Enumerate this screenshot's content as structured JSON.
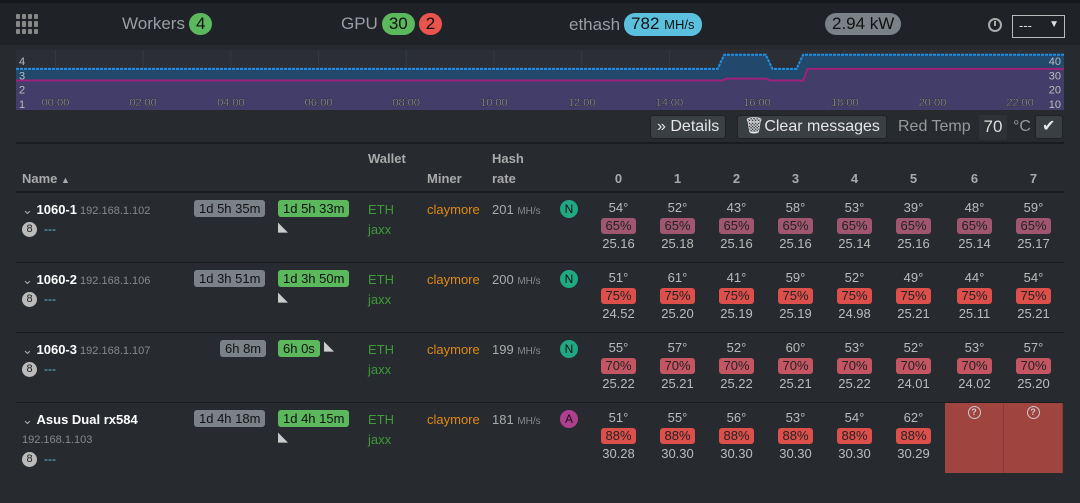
{
  "navbar": {
    "workers_label": "Workers",
    "workers_count": "4",
    "gpu_label": "GPU",
    "gpu_ok": "30",
    "gpu_bad": "2",
    "algo_label": "ethash",
    "hashrate": "782",
    "hashrate_unit": "MH/s",
    "power": "2.94 kW",
    "range_select": "---"
  },
  "chart_data": {
    "type": "area",
    "x_ticks": [
      "00:00",
      "02:00",
      "04:00",
      "06:00",
      "08:00",
      "10:00",
      "12:00",
      "14:00",
      "16:00",
      "18:00",
      "20:00",
      "22:00"
    ],
    "left_ticks": [
      "1",
      "2",
      "3",
      "4"
    ],
    "right_ticks": [
      "10",
      "20",
      "30",
      "40"
    ],
    "xlim_hours": [
      -0.9,
      23
    ],
    "ylim_right": [
      7,
      50
    ],
    "series": [
      {
        "color": "#1e90e6",
        "points": [
          [
            -0.9,
            36.5
          ],
          [
            15.1,
            36.5
          ],
          [
            15.25,
            46.6
          ],
          [
            16.2,
            46.6
          ],
          [
            16.35,
            36.5
          ],
          [
            16.9,
            36.5
          ],
          [
            17.05,
            46.6
          ],
          [
            23,
            46.6
          ]
        ]
      },
      {
        "color": "#a0207a",
        "points": [
          [
            -0.9,
            28.1
          ],
          [
            15.2,
            28.1
          ],
          [
            15.3,
            29.5
          ],
          [
            16.2,
            29.5
          ],
          [
            16.3,
            28.1
          ],
          [
            17.05,
            28.1
          ],
          [
            17.15,
            36.5
          ],
          [
            23,
            36.5
          ]
        ]
      }
    ]
  },
  "toolbar": {
    "details": "Details",
    "clear": "Clear messages",
    "red_temp_label": "Red Temp",
    "red_temp": "70",
    "unit": "°C"
  },
  "table": {
    "headers": {
      "name": "Name",
      "wallet": "Wallet",
      "miner": "Miner",
      "hash1": "Hash",
      "hash2": "rate",
      "gpus": [
        "0",
        "1",
        "2",
        "3",
        "4",
        "5",
        "6",
        "7"
      ]
    },
    "rows": [
      {
        "name": "1060-1",
        "ip": "192.168.1.102",
        "count": "8",
        "note": "---",
        "up1": "1d 5h 35m",
        "up2": "1d 5h 33m",
        "coin": "ETH",
        "wallet": "jaxx",
        "miner": "claymore",
        "hash": "201",
        "unit": "MH/s",
        "type": "N",
        "typecolor": "#1fa883",
        "pctcolor": "#a0566e",
        "gpus": [
          [
            "54°",
            "65%",
            "25.16"
          ],
          [
            "52°",
            "65%",
            "25.18"
          ],
          [
            "43°",
            "65%",
            "25.16"
          ],
          [
            "58°",
            "65%",
            "25.16"
          ],
          [
            "53°",
            "65%",
            "25.14"
          ],
          [
            "39°",
            "65%",
            "25.16"
          ],
          [
            "48°",
            "65%",
            "25.14"
          ],
          [
            "59°",
            "65%",
            "25.17"
          ]
        ]
      },
      {
        "name": "1060-2",
        "ip": "192.168.1.106",
        "count": "8",
        "note": "---",
        "up1": "1d 3h 51m",
        "up2": "1d 3h 50m",
        "coin": "ETH",
        "wallet": "jaxx",
        "miner": "claymore",
        "hash": "200",
        "unit": "MH/s",
        "type": "N",
        "typecolor": "#1fa883",
        "pctcolor": "#dc4f4a",
        "gpus": [
          [
            "51°",
            "75%",
            "24.52"
          ],
          [
            "61°",
            "75%",
            "25.20"
          ],
          [
            "41°",
            "75%",
            "25.19"
          ],
          [
            "59°",
            "75%",
            "25.19"
          ],
          [
            "52°",
            "75%",
            "24.98"
          ],
          [
            "49°",
            "75%",
            "25.21"
          ],
          [
            "44°",
            "75%",
            "25.11"
          ],
          [
            "54°",
            "75%",
            "25.21"
          ]
        ]
      },
      {
        "name": "1060-3",
        "ip": "192.168.1.107",
        "count": "8",
        "note": "---",
        "up1": "6h 8m",
        "up2": "6h 0s",
        "coin": "ETH",
        "wallet": "jaxx",
        "miner": "claymore",
        "hash": "199",
        "unit": "MH/s",
        "type": "N",
        "typecolor": "#1fa883",
        "pctcolor": "#c45563",
        "gpus": [
          [
            "55°",
            "70%",
            "25.22"
          ],
          [
            "57°",
            "70%",
            "25.21"
          ],
          [
            "52°",
            "70%",
            "25.22"
          ],
          [
            "60°",
            "70%",
            "25.21"
          ],
          [
            "53°",
            "70%",
            "25.22"
          ],
          [
            "52°",
            "70%",
            "24.01"
          ],
          [
            "53°",
            "70%",
            "24.02"
          ],
          [
            "57°",
            "70%",
            "25.20"
          ]
        ]
      },
      {
        "name": "Asus Dual rx584",
        "ip": "192.168.1.103",
        "count": "8",
        "note": "---",
        "up1": "1d 4h 18m",
        "up2": "1d 4h 15m",
        "coin": "ETH",
        "wallet": "jaxx",
        "miner": "claymore",
        "hash": "181",
        "unit": "MH/s",
        "type": "A",
        "typecolor": "#b0408f",
        "pctcolor": "#dc4f4a",
        "gpus": [
          [
            "51°",
            "88%",
            "30.28"
          ],
          [
            "55°",
            "88%",
            "30.30"
          ],
          [
            "56°",
            "88%",
            "30.30"
          ],
          [
            "53°",
            "88%",
            "30.30"
          ],
          [
            "54°",
            "88%",
            "30.30"
          ],
          [
            "62°",
            "88%",
            "30.29"
          ],
          null,
          null
        ]
      }
    ]
  }
}
